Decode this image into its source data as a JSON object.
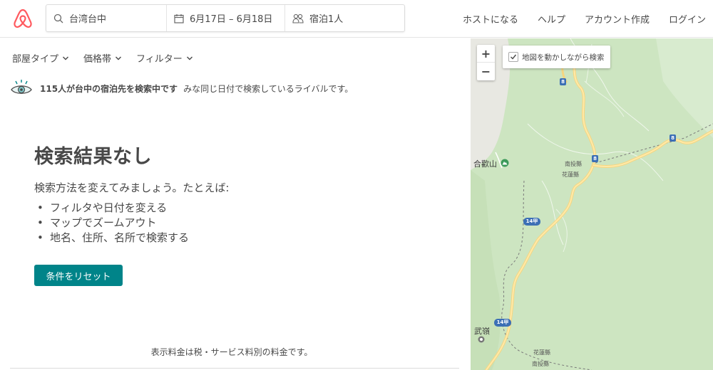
{
  "header": {
    "search": {
      "location": "台湾台中",
      "dates": "6月17日 – 6月18日",
      "guests": "宿泊1人"
    },
    "nav": [
      "ホストになる",
      "ヘルプ",
      "アカウント作成",
      "ログイン"
    ]
  },
  "filters": [
    {
      "label": "部屋タイプ"
    },
    {
      "label": "価格帯"
    },
    {
      "label": "フィルター"
    }
  ],
  "notice": {
    "bold": "115人が台中の宿泊先を検索中です",
    "rest": "みな同じ日付で検索しているライバルです。"
  },
  "no_results": {
    "title": "検索結果なし",
    "subtitle": "検索方法を変えてみましょう。たとえば:",
    "tips": [
      "フィルタや日付を変える",
      "マップでズームアウト",
      "地名、住所、名所で検索する"
    ],
    "reset_label": "条件をリセット"
  },
  "footnote": "表示料金は税・サービス料別の料金です。",
  "map": {
    "zoom_in": "+",
    "zoom_out": "−",
    "move_search_label": "地図を動かしながら検索",
    "move_search_checked": true,
    "places": {
      "mountain": "合歡山",
      "town": "武嶺",
      "county1": "南投縣",
      "county2": "花蓮縣",
      "county3": "花蓮縣",
      "county4": "南投縣"
    },
    "shields": {
      "r8a": "8",
      "r8b": "8",
      "r8c": "8",
      "r14a": "14甲",
      "r14b": "14甲"
    }
  },
  "colors": {
    "brand": "#FF5A5F",
    "accent": "#008489",
    "map_green": "#cfe6c4",
    "road": "#f7d774"
  }
}
